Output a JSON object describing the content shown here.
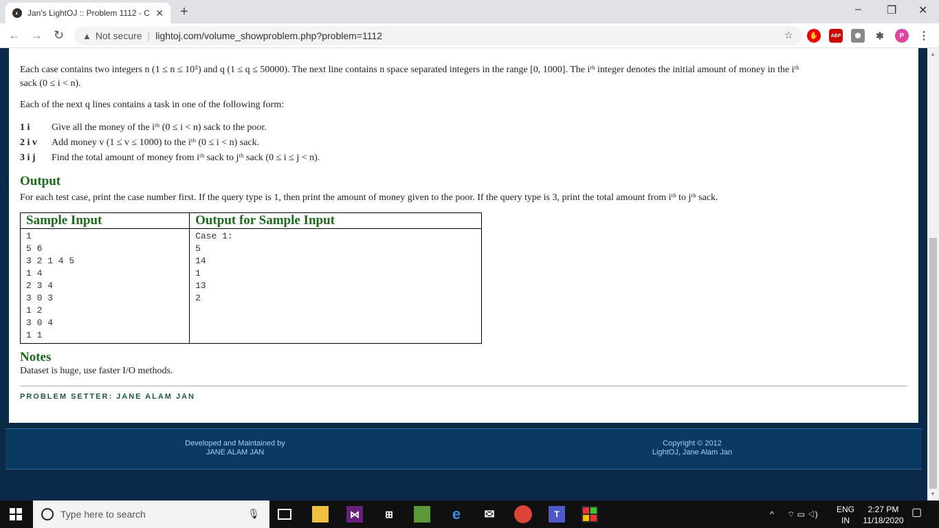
{
  "browser": {
    "tab_title": "Jan's LightOJ :: Problem 1112 - C",
    "url_warning": "Not secure",
    "url": "lightoj.com/volume_showproblem.php?problem=1112"
  },
  "problem": {
    "input_para": "Each case contains two integers n (1 ≤ n ≤ 10⁵) and q (1 ≤ q ≤ 50000). The next line contains n space separated integers in the range [0, 1000]. The iᵗʰ integer denotes the initial amount of money in the iᵗʰ",
    "input_para2": "sack (0 ≤ i < n).",
    "next_lines": "Each of the next q lines contains a task in one of the following form:",
    "tasks": [
      {
        "code": "1 i",
        "text": "Give all the money of the iᵗʰ (0 ≤ i < n) sack to the poor."
      },
      {
        "code": "2 i v",
        "text": "Add money v (1 ≤ v ≤ 1000) to the iᵗʰ (0 ≤ i < n) sack."
      },
      {
        "code": "3 i j",
        "text": "Find the total amount of money from iᵗʰ sack to jᵗʰ sack (0 ≤ i ≤ j < n)."
      }
    ],
    "output_heading": "Output",
    "output_text": "For each test case, print the case number first. If the query type is 1, then print the amount of money given to the poor. If the query type is 3, print the total amount from iᵗʰ to jᵗʰ sack.",
    "sample_input_heading": "Sample Input",
    "sample_output_heading": "Output for Sample Input",
    "sample_input": [
      "1",
      "5 6",
      "3 2 1 4 5",
      "1 4",
      "2 3 4",
      "3 0 3",
      "1 2",
      "3 0 4",
      "1 1"
    ],
    "sample_output": [
      "Case 1:",
      "5",
      "14",
      "1",
      "13",
      "2"
    ],
    "notes_heading": "Notes",
    "notes_text": "Dataset is huge, use faster I/O methods.",
    "setter": "PROBLEM SETTER: JANE ALAM JAN"
  },
  "footer": {
    "left_line1": "Developed and Maintained by",
    "left_line2": "JANE ALAM JAN",
    "right_line1": "Copyright © 2012",
    "right_line2": "LightOJ, Jane Alam Jan"
  },
  "taskbar": {
    "search_placeholder": "Type here to search",
    "lang1": "ENG",
    "lang2": "IN",
    "time": "2:27 PM",
    "date": "11/18/2020"
  }
}
